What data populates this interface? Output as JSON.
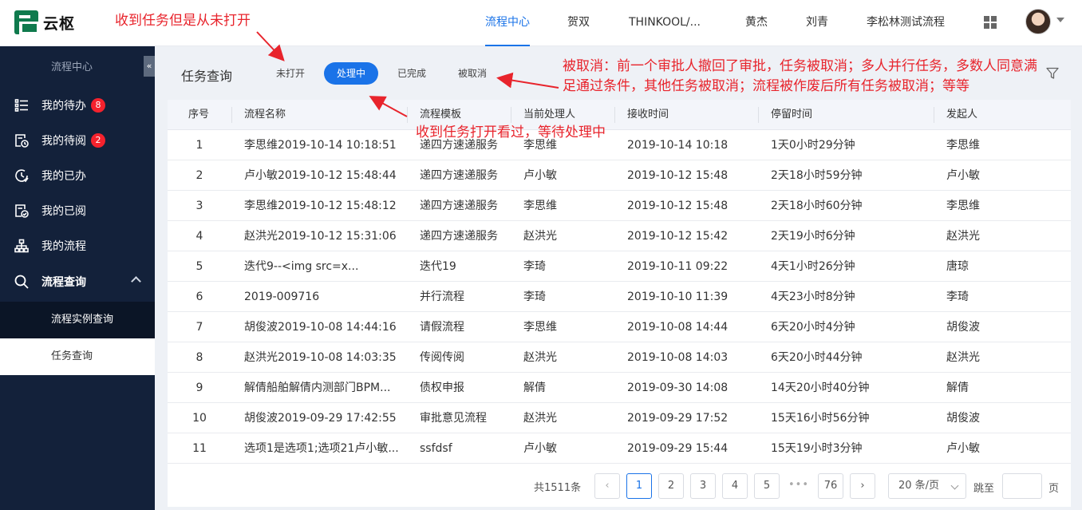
{
  "app": {
    "name": "云枢"
  },
  "header": {
    "nav": [
      "流程中心",
      "贺双",
      "THINKOOL/...",
      "黄杰",
      "刘青",
      "李松林测试流程"
    ],
    "active_nav": "流程中心"
  },
  "annotations": {
    "unopened_note": "收到任务但是从未打开",
    "processing_note": "收到任务打开看过，等待处理中",
    "cancelled_note": "被取消：前一个审批人撤回了审批，任务被取消；多人并行任务，多数人同意满足通过条件，其他任务被取消；流程被作废后所有任务被取消；等等"
  },
  "sidebar": {
    "title": "流程中心",
    "collapse_glyph": "«",
    "items": [
      {
        "label": "我的待办",
        "badge": "8"
      },
      {
        "label": "我的待阅",
        "badge": "2"
      },
      {
        "label": "我的已办"
      },
      {
        "label": "我的已阅"
      },
      {
        "label": "我的流程"
      },
      {
        "label": "流程查询"
      }
    ],
    "sub_items": [
      "流程实例查询",
      "任务查询"
    ],
    "active_sub": "任务查询"
  },
  "main": {
    "title": "任务查询",
    "tabs": [
      "未打开",
      "处理中",
      "已完成",
      "被取消"
    ],
    "active_tab": "处理中"
  },
  "table": {
    "columns": [
      "序号",
      "流程名称",
      "流程模板",
      "当前处理人",
      "接收时间",
      "停留时间",
      "发起人"
    ],
    "rows": [
      [
        "1",
        "李思维2019-10-14 10:18:51",
        "递四方速递服务",
        "李思维",
        "2019-10-14 10:18",
        "1天0小时29分钟",
        "李思维"
      ],
      [
        "2",
        "卢小敏2019-10-12 15:48:44",
        "递四方速递服务",
        "卢小敏",
        "2019-10-12 15:48",
        "2天18小时59分钟",
        "卢小敏"
      ],
      [
        "3",
        "李思维2019-10-12 15:48:12",
        "递四方速递服务",
        "李思维",
        "2019-10-12 15:48",
        "2天18小时60分钟",
        "李思维"
      ],
      [
        "4",
        "赵洪光2019-10-12 15:31:06",
        "递四方速递服务",
        "赵洪光",
        "2019-10-12 15:42",
        "2天19小时6分钟",
        "赵洪光"
      ],
      [
        "5",
        "迭代9--<img src=x...",
        "迭代19",
        "李琦",
        "2019-10-11 09:22",
        "4天1小时26分钟",
        "唐琼"
      ],
      [
        "6",
        "2019-009716",
        "并行流程",
        "李琦",
        "2019-10-10 11:39",
        "4天23小时8分钟",
        "李琦"
      ],
      [
        "7",
        "胡俊波2019-10-08 14:44:16",
        "请假流程",
        "李思维",
        "2019-10-08 14:44",
        "6天20小时4分钟",
        "胡俊波"
      ],
      [
        "8",
        "赵洪光2019-10-08 14:03:35",
        "传阅传阅",
        "赵洪光",
        "2019-10-08 14:03",
        "6天20小时44分钟",
        "赵洪光"
      ],
      [
        "9",
        "解倩船舶解倩内测部门BPM...",
        "债权申报",
        "解倩",
        "2019-09-30 14:08",
        "14天20小时40分钟",
        "解倩"
      ],
      [
        "10",
        "胡俊波2019-09-29 17:42:55",
        "审批意见流程",
        "赵洪光",
        "2019-09-29 17:52",
        "15天16小时56分钟",
        "胡俊波"
      ],
      [
        "11",
        "选项1是选项1;选项21卢小敏...",
        "ssfdsf",
        "卢小敏",
        "2019-09-29 15:44",
        "15天19小时3分钟",
        "卢小敏"
      ]
    ]
  },
  "pagination": {
    "total_label": "共1511条",
    "pages": [
      "1",
      "2",
      "3",
      "4",
      "5"
    ],
    "ellipsis": "•••",
    "last_page": "76",
    "current_page": "1",
    "prev_glyph": "‹",
    "next_glyph": "›",
    "page_size": "20 条/页",
    "jump_label": "跳至",
    "page_suffix": "页"
  },
  "colors": {
    "accent": "#1a73e8",
    "sidebar_bg": "#13213a",
    "badge": "#f5222d",
    "annotation": "#e8242c"
  }
}
